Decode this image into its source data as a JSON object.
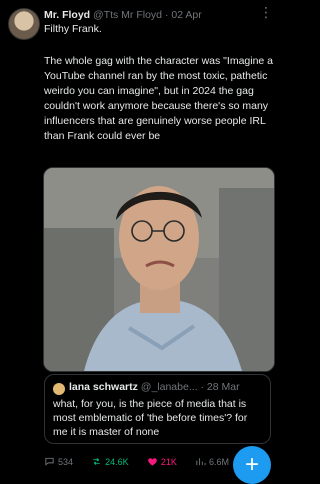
{
  "tweet": {
    "author": "Mr. Floyd",
    "handle": "@Tts Mr Floyd",
    "separator": "·",
    "date": "02 Apr",
    "subtitle": "Filthy Frank.",
    "body": "The whole gag with the character was \"Imagine a YouTube channel ran by the most toxic, pathetic weirdo you can imagine\", but in 2024 the gag couldn't work anymore because there's so many influencers that are genuinely worse people IRL than Frank could ever be",
    "more_label": "⋮"
  },
  "quote": {
    "author": "lana schwartz",
    "handle": "@_lanabe...",
    "separator": "·",
    "date": "28 Mar",
    "body": "what, for you, is the piece of media that is most emblematic of 'the before times'? for me it is master of none"
  },
  "actions": {
    "replies": "534",
    "retweets": "24.6K",
    "likes": "21K",
    "views": "6.6M"
  },
  "fab": {
    "label": "+"
  },
  "colors": {
    "accent": "#1d9bf0",
    "retweet": "#00ba7c",
    "like": "#f91880",
    "muted": "#71767b",
    "background": "#000000"
  }
}
